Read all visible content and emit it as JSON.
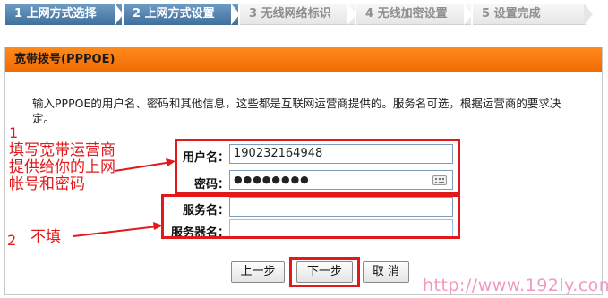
{
  "steps": [
    {
      "label": "1 上网方式选择"
    },
    {
      "label": "2 上网方式设置"
    },
    {
      "label": "3 无线网络标识"
    },
    {
      "label": "4 无线加密设置"
    },
    {
      "label": "5 设置完成"
    }
  ],
  "panel": {
    "title": "宽带拨号(PPPOE)",
    "description": "输入PPPOE的用户名、密码和其他信息，这些都是互联网运营商提供的。服务名可选，根据运营商的要求决定。"
  },
  "form": {
    "username_label": "用户名：",
    "username_value": "190232164948",
    "password_label": "密码：",
    "password_value": "●●●●●●●●",
    "service_name_label": "服务名：",
    "service_name_value": "",
    "server_name_label": "服务器名：",
    "server_name_value": ""
  },
  "buttons": {
    "prev": "上一步",
    "next": "下一步",
    "cancel": "取 消"
  },
  "annotations": {
    "num1": "1",
    "note1_line1": "填写宽带运营商",
    "note1_line2": "提供给你的上网",
    "note1_line3": "帐号和密码",
    "num2": "2",
    "note2": "不填"
  },
  "watermark": "http://www.192ly.com",
  "colors": {
    "accent_orange": "#f06a00",
    "step_active": "#4a7aa8",
    "annotation_red": "#e2191b"
  }
}
